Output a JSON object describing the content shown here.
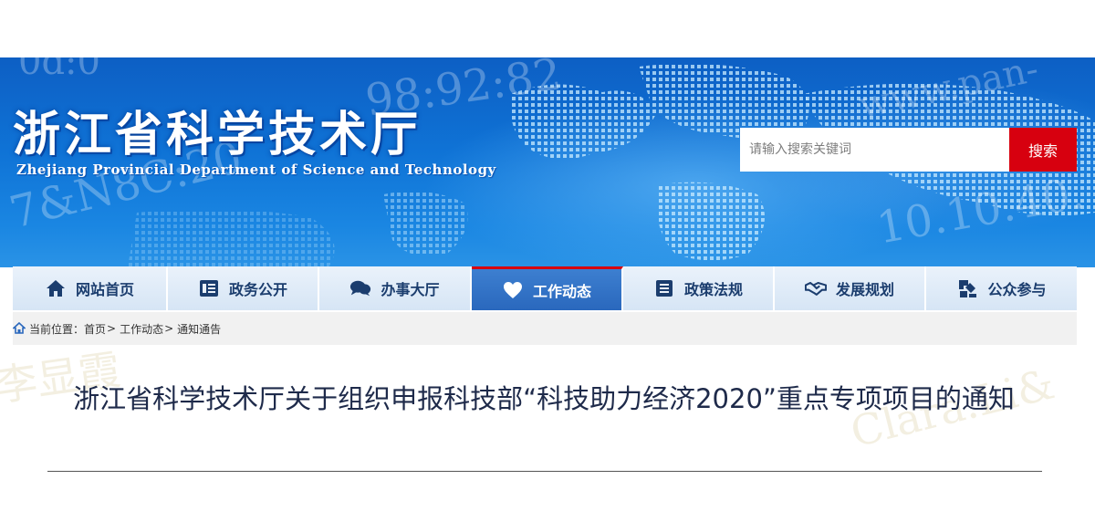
{
  "header": {
    "title": "浙江省科学技术厅",
    "subtitle": "Zhejiang Provincial Department of Science and Technology",
    "search_placeholder": "请输入搜索关键词",
    "search_button": "搜索"
  },
  "nav": {
    "items": [
      {
        "label": "网站首页",
        "icon": "home-icon"
      },
      {
        "label": "政务公开",
        "icon": "document-list-icon"
      },
      {
        "label": "办事大厅",
        "icon": "chat-bubbles-icon"
      },
      {
        "label": "工作动态",
        "icon": "heart-icon",
        "active": true
      },
      {
        "label": "政策法规",
        "icon": "list-icon"
      },
      {
        "label": "发展规划",
        "icon": "handshake-icon"
      },
      {
        "label": "公众参与",
        "icon": "participation-icon"
      }
    ]
  },
  "breadcrumb": {
    "prefix": "当前位置：",
    "items": [
      "首页",
      "工作动态",
      "通知通告"
    ],
    "separator": ">"
  },
  "article": {
    "title": "浙江省科学技术厅关于组织申报科技部“科技助力经济2020”重点专项项目的通知"
  },
  "watermarks": {
    "banner_left": "7&N8C:20",
    "banner_mid": "98:92:82",
    "banner_right_top": "www.pan-",
    "banner_right_bottom": "10.10.40.",
    "banner_topleft": "0d:0",
    "body_left": "李显霞",
    "body_right": "Clara.Li&"
  },
  "colors": {
    "banner_blue": "#0f73d6",
    "search_red": "#d7000f",
    "nav_active": "#2a68bd",
    "nav_bg": "#dce8f6"
  }
}
